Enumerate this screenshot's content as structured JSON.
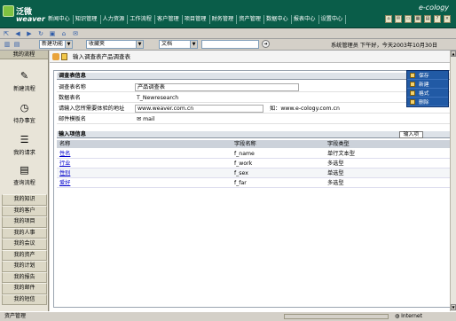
{
  "topbar": {
    "logo_cn": "泛微",
    "logo_en": "weaver",
    "brand": "e-cology",
    "nav": [
      "新闻中心",
      "知识管理",
      "人力资源",
      "工作流程",
      "客户管理",
      "项目管理",
      "财务管理",
      "资产管理",
      "数据中心",
      "报表中心",
      "设置中心"
    ],
    "icons": [
      "home-icon",
      "mail-icon",
      "folder-icon",
      "calendar-icon",
      "print-icon",
      "help-icon",
      "exit-icon"
    ]
  },
  "toolbar": {
    "icons": [
      "exit-icon",
      "back-icon",
      "forward-icon",
      "refresh-icon",
      "save-icon",
      "home-icon",
      "mail-icon"
    ]
  },
  "filterbar": {
    "select1": "新建功能",
    "select2": "收藏夹",
    "select3": "文档",
    "user_info": "系统管理员 下午好，今天2003年10月30日"
  },
  "sidebar": {
    "header": "我的流程",
    "actions": [
      {
        "label": "新建流程",
        "icon": "pencil-icon"
      },
      {
        "label": "待办事宜",
        "icon": "clock-icon"
      },
      {
        "label": "我的请求",
        "icon": "request-icon"
      },
      {
        "label": "查询流程",
        "icon": "search-doc-icon"
      }
    ],
    "menu": [
      "我的知识",
      "我的客户",
      "我的项目",
      "我的人事",
      "我的会议",
      "我的资产",
      "我的计划",
      "我的报告",
      "我的邮件",
      "我的短信"
    ]
  },
  "breadcrumb": {
    "text": "输入调查表产品调查表"
  },
  "form": {
    "section_title": "调查表信息",
    "fields": [
      {
        "label": "调查表名称",
        "value": "产品调查表"
      },
      {
        "label": "数据表名",
        "value": "T_Newresearch"
      },
      {
        "label": "请输入您所需要体验的地址",
        "value": "www.weaver.com.cn",
        "hint": "如：www.e-cology.com.cn"
      },
      {
        "label": "邮件模板名",
        "value": "mail"
      }
    ]
  },
  "items": {
    "section_title": "输入项信息",
    "add_button": "输入项",
    "columns": [
      "名称",
      "字段名称",
      "字段类型"
    ],
    "rows": [
      [
        "性名",
        "f_name",
        "单行文本型"
      ],
      [
        "行业",
        "f_work",
        "多选型"
      ],
      [
        "性别",
        "f_sex",
        "单选型"
      ],
      [
        "爱好",
        "f_far",
        "多选型"
      ]
    ]
  },
  "context_menu": {
    "items": [
      "保存",
      "新建",
      "格式",
      "删除"
    ]
  },
  "statusbar": {
    "left": "资产管理",
    "zone": "Internet"
  }
}
